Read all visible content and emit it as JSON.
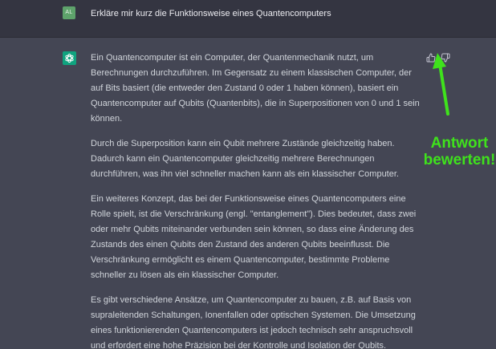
{
  "user": {
    "avatar_initials": "AL",
    "message": "Erkläre mir kurz die Funktionsweise eines Quantencomputers"
  },
  "assistant": {
    "avatar_icon": "openai-logo-icon",
    "paragraphs": [
      "Ein Quantencomputer ist ein Computer, der Quantenmechanik nutzt, um Berechnungen durchzuführen. Im Gegensatz zu einem klassischen Computer, der auf Bits basiert (die entweder den Zustand 0 oder 1 haben können), basiert ein Quantencomputer auf Qubits (Quantenbits), die in Superpositionen von 0 und 1 sein können.",
      "Durch die Superposition kann ein Qubit mehrere Zustände gleichzeitig haben. Dadurch kann ein Quantencomputer gleichzeitig mehrere Berechnungen durchführen, was ihn viel schneller machen kann als ein klassischer Computer.",
      "Ein weiteres Konzept, das bei der Funktionsweise eines Quantencomputers eine Rolle spielt, ist die Verschränkung (engl. \"entanglement\"). Dies bedeutet, dass zwei oder mehr Qubits miteinander verbunden sein können, so dass eine Änderung des Zustands des einen Qubits den Zustand des anderen Qubits beeinflusst. Die Verschränkung ermöglicht es einem Quantencomputer, bestimmte Probleme schneller zu lösen als ein klassischer Computer.",
      "Es gibt verschiedene Ansätze, um Quantencomputer zu bauen, z.B. auf Basis von supraleitenden Schaltungen, Ionenfallen oder optischen Systemen. Die Umsetzung eines funktionierenden Quantencomputers ist jedoch technisch sehr anspruchsvoll und erfordert eine hohe Präzision bei der Kontrolle und Isolation der Qubits."
    ]
  },
  "feedback": {
    "thumbs_up_icon": "thumbs-up-icon",
    "thumbs_down_icon": "thumbs-down-icon"
  },
  "annotation": {
    "line1": "Antwort",
    "line2": "bewerten!",
    "color": "#3fe21c"
  },
  "colors": {
    "user_bg": "#343541",
    "assistant_bg": "#444654",
    "bot_avatar": "#10a37f",
    "user_avatar": "#5ea36b"
  }
}
